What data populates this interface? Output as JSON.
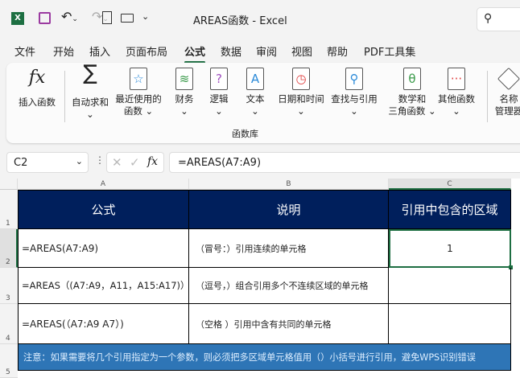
{
  "titlebar": {
    "title": "AREAS函数  -  Excel",
    "icons": [
      "excel-logo",
      "save-icon",
      "undo-icon",
      "redo-icon",
      "new-file-icon",
      "open-folder-icon",
      "customize-icon",
      "search-icon"
    ]
  },
  "tabs": [
    "文件",
    "开始",
    "插入",
    "页面布局",
    "公式",
    "数据",
    "审阅",
    "视图",
    "帮助",
    "PDF工具集"
  ],
  "active_tab": "公式",
  "ribbon": {
    "group_label": "函数库",
    "buttons": [
      {
        "label": "插入函数",
        "label2": "",
        "icon": "fx-icon"
      },
      {
        "label": "自动求和",
        "label2": "⌄",
        "icon": "sigma-icon"
      },
      {
        "label": "最近使用的",
        "label2": "函数 ⌄",
        "icon": "star-book-icon"
      },
      {
        "label": "财务",
        "label2": "⌄",
        "icon": "finance-book-icon"
      },
      {
        "label": "逻辑",
        "label2": "⌄",
        "icon": "logic-book-icon"
      },
      {
        "label": "文本",
        "label2": "⌄",
        "icon": "text-book-icon"
      },
      {
        "label": "日期和时间",
        "label2": "⌄",
        "icon": "clock-book-icon"
      },
      {
        "label": "查找与引用",
        "label2": "⌄",
        "icon": "lookup-book-icon"
      },
      {
        "label": "数学和",
        "label2": "三角函数 ⌄",
        "icon": "theta-book-icon"
      },
      {
        "label": "其他函数",
        "label2": "⌄",
        "icon": "more-book-icon"
      },
      {
        "label": "名称",
        "label2": "管理器",
        "icon": "name-manager-icon"
      }
    ]
  },
  "formula_bar": {
    "name_box": "C2",
    "formula": "=AREAS(A7:A9)"
  },
  "columns": [
    "A",
    "B",
    "C"
  ],
  "rows": [
    "1",
    "2",
    "3",
    "4",
    "5"
  ],
  "sheet": {
    "header": [
      "公式",
      "说明",
      "引用中包含的区域"
    ],
    "data": [
      [
        "=AREAS(A7:A9)",
        "（冒号：）引用连续的单元格",
        "1"
      ],
      [
        "=AREAS（(A7:A9，A11，A15:A17)）",
        "（逗号，）组合引用多个不连续区域的单元格",
        ""
      ],
      [
        "=AREAS(（A7:A9 A7）)",
        "（空格 ）引用中含有共同的单元格",
        ""
      ]
    ],
    "note": "注意：如果需要将几个引用指定为一个参数，则必须把多区域单元格值用（）小括号进行引用，避免WPS识别错误"
  },
  "colors": {
    "header_bg": "#001f5c",
    "note_bg": "#2e75b6",
    "selection": "#1e6e42",
    "accent": "#1e6e42"
  }
}
